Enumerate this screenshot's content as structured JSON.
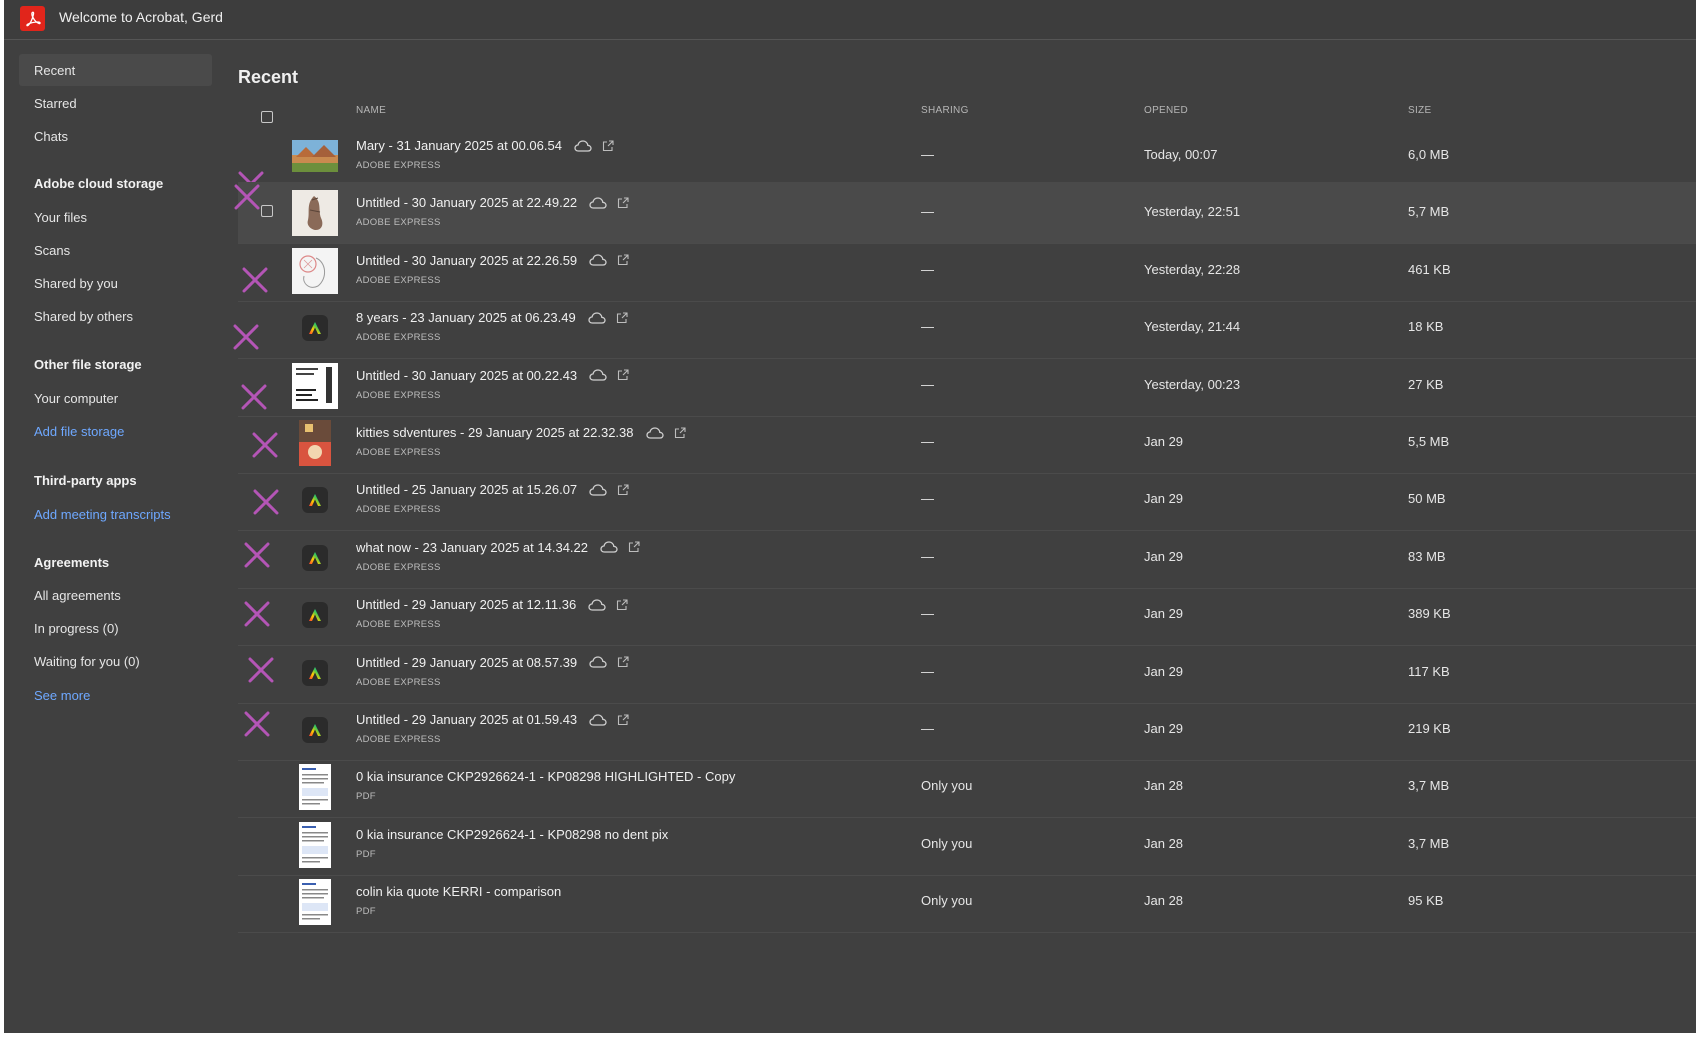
{
  "app": {
    "title": "Welcome to Acrobat, Gerd",
    "brand_color": "#e1251b",
    "annotation_color": "#b455b6",
    "link_color": "#6ea8ff"
  },
  "sidebar": {
    "recent": "Recent",
    "starred": "Starred",
    "chats": "Chats",
    "cloud_head": "Adobe cloud storage",
    "your_files": "Your files",
    "scans": "Scans",
    "shared_by_you": "Shared by you",
    "shared_by_others": "Shared by others",
    "other_head": "Other file storage",
    "your_computer": "Your computer",
    "add_file_storage": "Add file storage",
    "third_head": "Third-party apps",
    "add_meeting_transcripts": "Add meeting transcripts",
    "agreements_head": "Agreements",
    "all_agreements": "All agreements",
    "in_progress": "In progress (0)",
    "waiting_for_you": "Waiting for you (0)",
    "see_more": "See more"
  },
  "main": {
    "title": "Recent",
    "columns": {
      "name": "NAME",
      "sharing": "SHARING",
      "opened": "OPENED",
      "size": "SIZE"
    }
  },
  "files": [
    {
      "name": "Mary  - 31 January 2025 at 00.06.54",
      "type": "ADOBE EXPRESS",
      "sharing": "—",
      "opened": "Today, 00:07",
      "size": "6,0 MB",
      "thumb": "landscape-thumbnail"
    },
    {
      "name": "Untitled - 30 January 2025 at 22.49.22",
      "type": "ADOBE EXPRESS",
      "sharing": "—",
      "opened": "Yesterday, 22:51",
      "size": "5,7 MB",
      "thumb": "sketch-thumbnail"
    },
    {
      "name": "Untitled - 30 January 2025 at 22.26.59",
      "type": "ADOBE EXPRESS",
      "sharing": "—",
      "opened": "Yesterday, 22:28",
      "size": "461 KB",
      "thumb": "drawing-thumbnail"
    },
    {
      "name": "8 years  - 23 January 2025 at 06.23.49",
      "type": "ADOBE EXPRESS",
      "sharing": "—",
      "opened": "Yesterday, 21:44",
      "size": "18 KB",
      "thumb": "adobe-express-icon"
    },
    {
      "name": "Untitled - 30 January 2025 at 00.22.43",
      "type": "ADOBE EXPRESS",
      "sharing": "—",
      "opened": "Yesterday, 00:23",
      "size": "27 KB",
      "thumb": "text-thumbnail"
    },
    {
      "name": "kitties sdventures - 29 January 2025 at 22.32.38",
      "type": "ADOBE EXPRESS",
      "sharing": "—",
      "opened": "Jan 29",
      "size": "5,5 MB",
      "thumb": "poster-thumbnail"
    },
    {
      "name": "Untitled - 25 January 2025 at 15.26.07",
      "type": "ADOBE EXPRESS",
      "sharing": "—",
      "opened": "Jan 29",
      "size": "50 MB",
      "thumb": "adobe-express-icon"
    },
    {
      "name": "what now  - 23 January 2025 at 14.34.22",
      "type": "ADOBE EXPRESS",
      "sharing": "—",
      "opened": "Jan 29",
      "size": "83 MB",
      "thumb": "adobe-express-icon"
    },
    {
      "name": "Untitled - 29 January 2025 at 12.11.36",
      "type": "ADOBE EXPRESS",
      "sharing": "—",
      "opened": "Jan 29",
      "size": "389 KB",
      "thumb": "adobe-express-icon"
    },
    {
      "name": "Untitled - 29 January 2025 at 08.57.39",
      "type": "ADOBE EXPRESS",
      "sharing": "—",
      "opened": "Jan 29",
      "size": "117 KB",
      "thumb": "adobe-express-icon"
    },
    {
      "name": "Untitled - 29 January 2025 at 01.59.43",
      "type": "ADOBE EXPRESS",
      "sharing": "—",
      "opened": "Jan 29",
      "size": "219 KB",
      "thumb": "adobe-express-icon"
    },
    {
      "name": "0  kia insurance   CKP2926624-1 - KP08298  HIGHLIGHTED - Copy",
      "type": "PDF",
      "sharing": "Only you",
      "opened": "Jan 28",
      "size": "3,7 MB",
      "thumb": "pdf-thumbnail"
    },
    {
      "name": "0  kia insurance   CKP2926624-1 - KP08298   no dent pix",
      "type": "PDF",
      "sharing": "Only you",
      "opened": "Jan 28",
      "size": "3,7 MB",
      "thumb": "pdf-thumbnail"
    },
    {
      "name": "colin kia quote  KERRI - comparison",
      "type": "PDF",
      "sharing": "Only you",
      "opened": "Jan 28",
      "size": "95 KB",
      "thumb": "pdf-thumbnail"
    }
  ]
}
